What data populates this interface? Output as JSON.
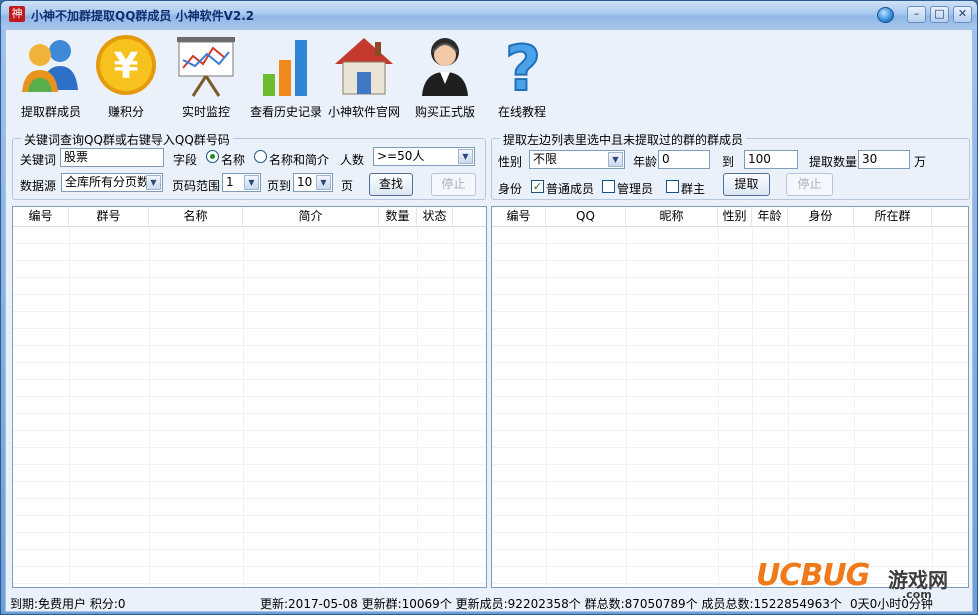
{
  "window": {
    "title": "小神不加群提取QQ群成员  小神软件V2.2",
    "icon_char": "神"
  },
  "titlebar_buttons": {
    "minimize": "–",
    "maximize": "□",
    "close": "✕"
  },
  "toolbar": [
    {
      "label": "提取群成员",
      "icon": "users-icon"
    },
    {
      "label": "赚积分",
      "icon": "yen-coin-icon"
    },
    {
      "label": "实时监控",
      "icon": "chart-board-icon"
    },
    {
      "label": "查看历史记录",
      "icon": "bar-chart-icon"
    },
    {
      "label": "小神软件官网",
      "icon": "home-icon"
    },
    {
      "label": "购买正式版",
      "icon": "support-agent-icon"
    },
    {
      "label": "在线教程",
      "icon": "question-icon"
    }
  ],
  "left": {
    "group_title": "关键词查询QQ群或右键导入QQ群号码",
    "keyword_label": "关键词",
    "keyword_value": "股票",
    "field_label": "字段",
    "radio_name": "名称",
    "radio_name_intro": "名称和简介",
    "people_label": "人数",
    "people_value": ">=50人",
    "source_label": "数据源",
    "source_value": "全库所有分页数",
    "page_range_label": "页码范围",
    "page_from": "1",
    "page_to_label": "页到",
    "page_to": "10",
    "page_unit": "页",
    "search_button": "查找",
    "stop_button": "停止",
    "columns": [
      "编号",
      "群号",
      "名称",
      "简介",
      "数量",
      "状态"
    ]
  },
  "right": {
    "group_title": "提取左边列表里选中且未提取过的群的群成员",
    "gender_label": "性别",
    "gender_value": "不限",
    "age_label": "年龄",
    "age_from": "0",
    "age_to_label": "到",
    "age_to": "100",
    "count_label": "提取数量",
    "count_value": "30",
    "count_unit": "万",
    "identity_label": "身份",
    "chk_normal": "普通成员",
    "chk_admin": "管理员",
    "chk_owner": "群主",
    "extract_button": "提取",
    "stop_button": "停止",
    "columns": [
      "编号",
      "QQ",
      "昵称",
      "性别",
      "年龄",
      "身份",
      "所在群"
    ]
  },
  "status": {
    "left": "到期:免费用户 积分:0",
    "right": "更新:2017-05-08 更新群:10069个 更新成员:92202358个 群总数:87050789个 成员总数:1522854963个",
    "time": "0天0小时0分钟"
  },
  "watermark": {
    "brand": "UCBUG",
    "cn": "游戏网",
    "domain": ".com"
  },
  "colors": {
    "title_text": "#0d2e6e",
    "accent_blue": "#2e6fc8",
    "watermark_orange": "#f07a1a"
  }
}
